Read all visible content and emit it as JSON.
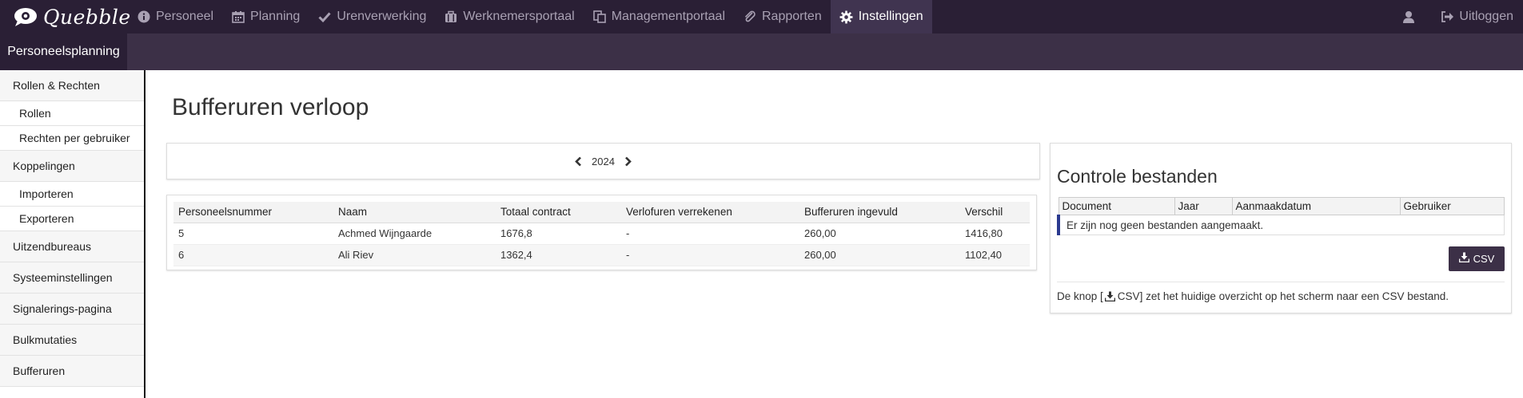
{
  "brand": {
    "name": "Quebble"
  },
  "nav": {
    "items": [
      {
        "label": "Personeel",
        "icon": "info-icon"
      },
      {
        "label": "Planning",
        "icon": "calendar-icon"
      },
      {
        "label": "Urenverwerking",
        "icon": "check-icon"
      },
      {
        "label": "Werknemersportaal",
        "icon": "briefcase-icon"
      },
      {
        "label": "Managementportaal",
        "icon": "copy-icon"
      },
      {
        "label": "Rapporten",
        "icon": "paperclip-icon"
      },
      {
        "label": "Instellingen",
        "icon": "gear-icon",
        "active": true
      }
    ],
    "logout": "Uitloggen"
  },
  "module": {
    "label": "Personeelsplanning"
  },
  "sidebar": {
    "items": [
      {
        "label": "Rollen & Rechten"
      },
      {
        "label": "Rollen"
      },
      {
        "label": "Rechten per gebruiker"
      },
      {
        "label": "Koppelingen"
      },
      {
        "label": "Importeren"
      },
      {
        "label": "Exporteren"
      },
      {
        "label": "Uitzendbureaus"
      },
      {
        "label": "Systeeminstellingen"
      },
      {
        "label": "Signalerings-pagina"
      },
      {
        "label": "Bulkmutaties"
      },
      {
        "label": "Bufferuren"
      }
    ]
  },
  "page": {
    "title": "Bufferuren verloop",
    "year": "2024"
  },
  "table": {
    "headers": [
      "Personeelsnummer",
      "Naam",
      "Totaal contract",
      "Verlofuren verrekenen",
      "Bufferuren ingevuld",
      "Verschil"
    ],
    "rows": [
      [
        "5",
        "Achmed Wijngaarde",
        "1676,8",
        "-",
        "260,00",
        "1416,80"
      ],
      [
        "6",
        "Ali Riev",
        "1362,4",
        "-",
        "260,00",
        "1102,40"
      ]
    ]
  },
  "files": {
    "title": "Controle bestanden",
    "headers": [
      "Document",
      "Jaar",
      "Aanmaakdatum",
      "Gebruiker"
    ],
    "empty_message": "Er zijn nog geen bestanden aangemaakt.",
    "csv_label": "CSV",
    "note_prefix": "De knop [",
    "note_button": "CSV",
    "note_suffix": "] zet het huidige overzicht op het scherm naar een CSV bestand."
  },
  "colors": {
    "topbar": "#2a1f35",
    "subbar": "#3c3047",
    "active_nav": "#403450",
    "accent_border": "#2a3a8f"
  }
}
